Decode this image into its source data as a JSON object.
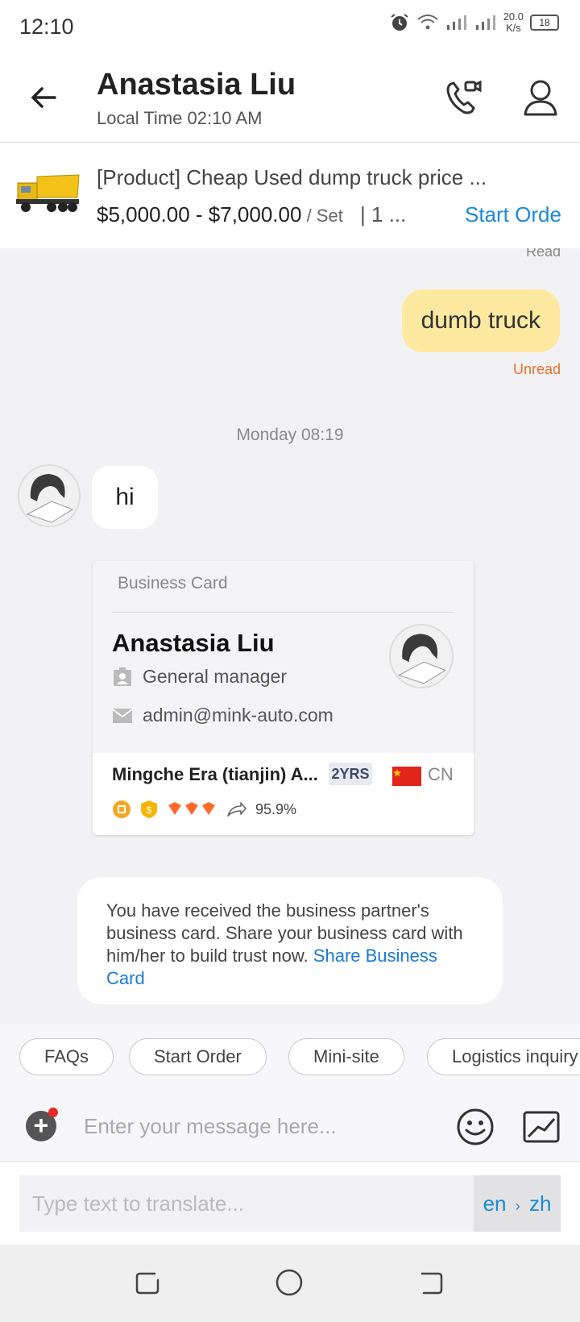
{
  "status_bar": {
    "time": "12:10",
    "speed_value": "20.0",
    "speed_unit": "K/s",
    "battery": "18"
  },
  "header": {
    "name": "Anastasia Liu",
    "local_time": "Local Time 02:10 AM"
  },
  "product": {
    "title": "[Product]  Cheap Used dump truck price ...",
    "price": "$5,000.00 - $7,000.00",
    "unit": " / Set",
    "min_order": "|  1 ...",
    "start_order": "Start Orde"
  },
  "chat": {
    "read_status": "Read",
    "sent_message": "dumb truck",
    "unread_status": "Unread",
    "date_divider": "Monday 08:19",
    "received_message": "hi"
  },
  "business_card": {
    "heading": "Business Card",
    "name": "Anastasia Liu",
    "title": "General manager",
    "email": "admin@mink-auto.com",
    "company": "Mingche Era (tianjin) A...",
    "years": "2YRS",
    "country": "CN",
    "response_rate": "95.9%"
  },
  "notice": {
    "text": "You have received the business partner's business card. Share your business card with him/her to build trust now. ",
    "link": "Share Business Card"
  },
  "quick_replies": [
    "FAQs",
    "Start Order",
    "Mini-site",
    "Logistics inquiry"
  ],
  "composer": {
    "placeholder": "Enter your message here..."
  },
  "translate": {
    "placeholder": "Type text to translate...",
    "from": "en",
    "arrow": "›",
    "to": "zh"
  },
  "colors": {
    "accent": "#1a8ad8",
    "sent_bubble": "#fde9a0",
    "unread": "#e8702a"
  }
}
